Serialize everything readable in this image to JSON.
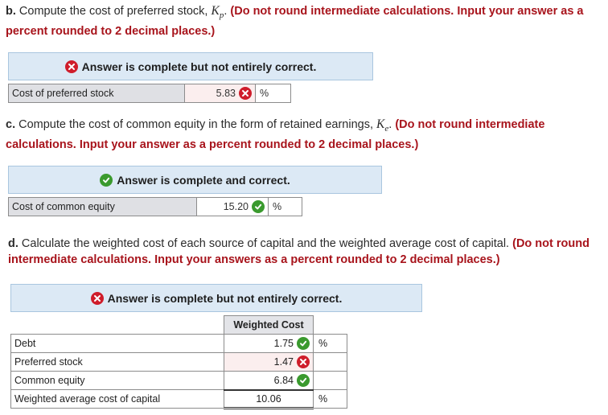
{
  "colors": {
    "accent_red": "#a8141c",
    "banner_bg": "#dce9f5",
    "error_icon": "#cf1d2b",
    "correct_icon": "#3a9a2e"
  },
  "part_b": {
    "lead": "b.",
    "text": " Compute the cost of preferred stock, ",
    "symbol": "K",
    "subscript": "p",
    "after_symbol": ". ",
    "instruction": "(Do not round intermediate calculations. Input your answer as a percent rounded to 2 decimal places.)",
    "banner": {
      "icon": "x-circle-icon",
      "text": "Answer is complete but not entirely correct."
    },
    "row": {
      "label": "Cost of preferred stock",
      "value": "5.83",
      "status_icon": "x-circle-icon",
      "unit": "%"
    }
  },
  "part_c": {
    "lead": "c.",
    "text": " Compute the cost of common equity in the form of retained earnings, ",
    "symbol": "K",
    "subscript": "e",
    "after_symbol": ". ",
    "instruction": "(Do not round intermediate calculations. Input your answer as a percent rounded to 2 decimal places.)",
    "banner": {
      "icon": "check-circle-icon",
      "text": "Answer is complete and correct."
    },
    "row": {
      "label": "Cost of common equity",
      "value": "15.20",
      "status_icon": "check-circle-icon",
      "unit": "%"
    }
  },
  "part_d": {
    "lead": "d.",
    "text": " Calculate the weighted cost of each source of capital and the weighted average cost of capital. ",
    "instruction": "(Do not round intermediate calculations. Input your answers as a percent rounded to 2 decimal places.)",
    "banner": {
      "icon": "x-circle-icon",
      "text": "Answer is complete but not entirely correct."
    },
    "table": {
      "header": "Weighted Cost",
      "rows": [
        {
          "label": "Debt",
          "value": "1.75",
          "status": "correct",
          "unit": "%"
        },
        {
          "label": "Preferred stock",
          "value": "1.47",
          "status": "incorrect",
          "unit": ""
        },
        {
          "label": "Common equity",
          "value": "6.84",
          "status": "correct",
          "unit": ""
        },
        {
          "label": "Weighted average cost of capital",
          "value": "10.06",
          "status": "",
          "unit": "%"
        }
      ]
    }
  }
}
